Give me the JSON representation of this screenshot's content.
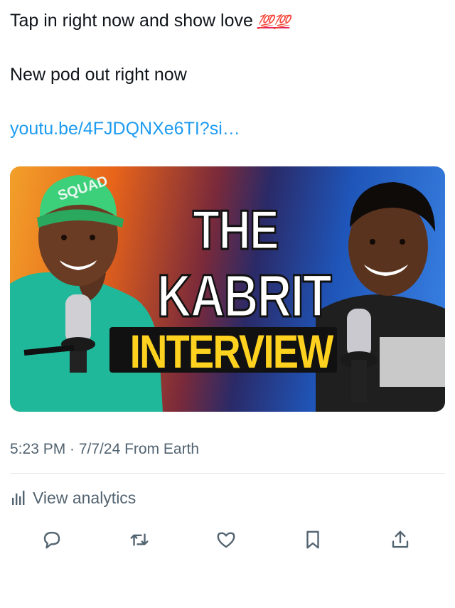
{
  "tweet": {
    "line1": "Tap in right now and show love",
    "emoji": "💯💯",
    "line2": "New pod out right now",
    "link": "youtu.be/4FJDQNXe6TI?si…"
  },
  "thumbnail": {
    "line1": "THE",
    "line2": "KABRIT",
    "line3": "INTERVIEW",
    "cap_text": "SQUAD"
  },
  "meta": {
    "timestamp": "5:23 PM · 7/7/24 From Earth"
  },
  "analytics": {
    "label": "View analytics",
    "icon": "bar-chart-icon"
  },
  "actions": [
    {
      "name": "reply",
      "icon": "reply-icon"
    },
    {
      "name": "retweet",
      "icon": "retweet-icon"
    },
    {
      "name": "like",
      "icon": "heart-icon"
    },
    {
      "name": "bookmark",
      "icon": "bookmark-icon"
    },
    {
      "name": "share",
      "icon": "share-icon"
    }
  ],
  "colors": {
    "link": "#1d9bf0",
    "muted": "#536471",
    "emoji": "#e0245e",
    "thumbnail_title": "#ffd21f"
  }
}
